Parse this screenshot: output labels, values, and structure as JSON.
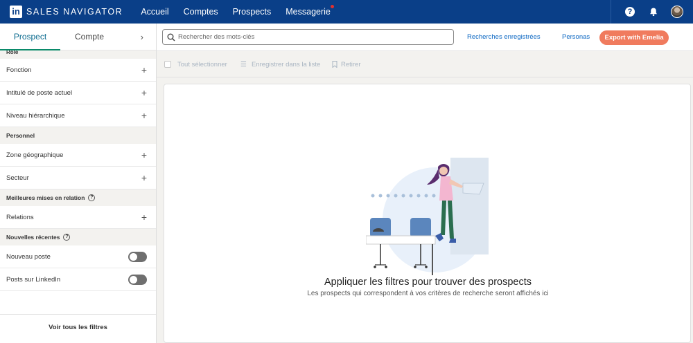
{
  "topbar": {
    "logo_letters": "in",
    "brand": "SALES NAVIGATOR",
    "nav": [
      "Accueil",
      "Comptes",
      "Prospects",
      "Messagerie"
    ],
    "icons": [
      "help-icon",
      "bell-icon",
      "avatar"
    ]
  },
  "left": {
    "tabs": {
      "active": "Prospect",
      "second": "Compte",
      "chevron": "›"
    },
    "cut_section": "Rôle",
    "group_role": [
      "Fonction",
      "Intitulé de poste actuel",
      "Niveau hiérarchique"
    ],
    "section_personnel": "Personnel",
    "group_personnel": [
      "Zone géographique",
      "Secteur"
    ],
    "section_relations": "Meilleures mises en relation",
    "relations_item": "Relations",
    "section_news": "Nouvelles récentes",
    "news_items": [
      "Nouveau poste",
      "Posts sur LinkedIn"
    ],
    "see_all": "Voir tous les filtres",
    "plus": "+",
    "qmark": "?"
  },
  "search": {
    "placeholder": "Rechercher des mots-clés",
    "saved": "Recherches enregistrées",
    "personas": "Personas",
    "export": "Export with Emelia"
  },
  "actions": {
    "select_all": "Tout sélectionner",
    "save_list": "Enregistrer dans la liste",
    "remove": "Retirer"
  },
  "results": {
    "title": "Appliquer les filtres pour trouver des prospects",
    "subtitle": "Les prospects qui correspondent à vos critères de recherche seront affichés ici"
  },
  "colors": {
    "topbar": "#0a3f88",
    "accent_link": "#0a66c2",
    "export": "#f07b5e",
    "active_tab_underline": "#0a8a6a"
  }
}
